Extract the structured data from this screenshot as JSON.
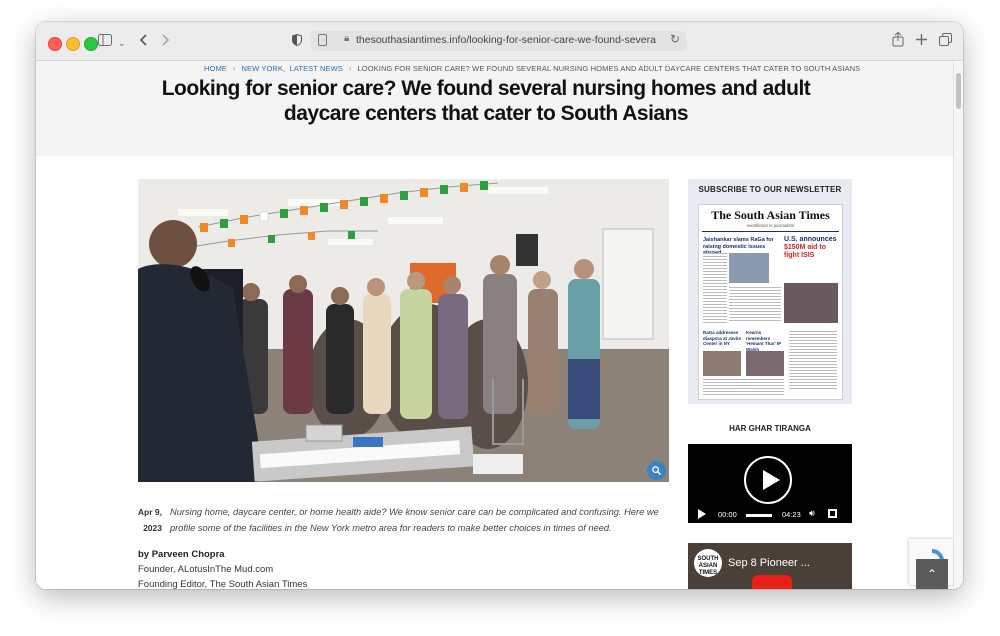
{
  "browser": {
    "url": "thesouthasiantimes.info/looking-for-senior-care-we-found-several-nursing-hon"
  },
  "breadcrumb": {
    "home": "HOME",
    "category1": "NEW YORK,",
    "category2": "LATEST NEWS",
    "current": "LOOKING FOR SENIOR CARE? WE FOUND SEVERAL NURSING HOMES AND ADULT DAYCARE CENTERS THAT CATER TO SOUTH ASIANS"
  },
  "article": {
    "title": "Looking for senior care? We found several nursing homes and adult daycare centers that cater to South Asians",
    "date_line1": "Apr 9,",
    "date_line2": "2023",
    "excerpt": "Nursing home, daycare center, or home health aide? We know senior care can be complicated and confusing. Here we profile some of the facilities in the New York metro area for readers to make better choices in times of need.",
    "author": "by Parveen Chopra",
    "author_role1": "Founder, ALotusInThe Mud.com",
    "author_role2": "Founding Editor, The South Asian Times"
  },
  "sidebar": {
    "newsletter_title": "SUBSCRIBE TO OUR NEWSLETTER",
    "newspaper": {
      "masthead": "The South Asian Times",
      "tagline": "excellence in journalism",
      "headline1": "Jaishankar slams RaGa for raising domestic issues abroad",
      "headline2_a": "U.S. announces",
      "headline2_b": "$150M aid to fight ISIS",
      "headline3": "RaGa addresses diaspora at Javits Center in NY",
      "headline4": "Kearns remembers 'Hemant Thar' IP Walsh"
    },
    "har_title": "HAR GHAR TIRANGA",
    "video1": {
      "current_time": "00:00",
      "duration": "04:23"
    },
    "video2": {
      "channel_logo": "SOUTH ASIAN TIMES",
      "title": "Sep 8 Pioneer ..."
    }
  },
  "icons": {
    "zoom": "search-icon",
    "to_top": "chevron-up-icon"
  }
}
